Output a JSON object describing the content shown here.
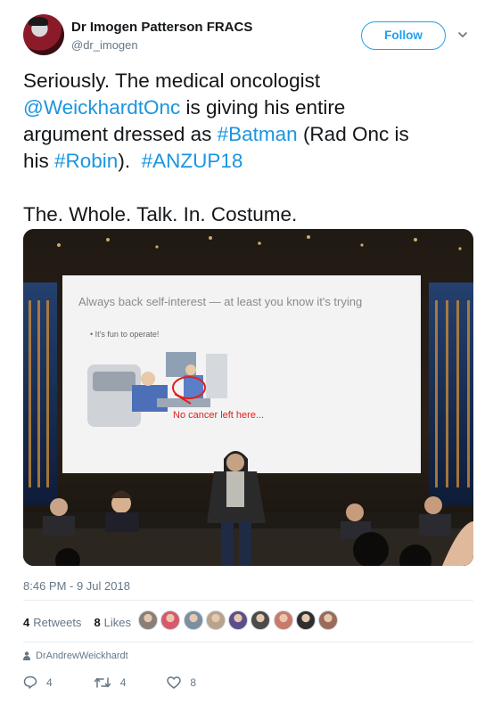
{
  "author": {
    "name": "Dr Imogen Patterson FRACS",
    "handle": "@dr_imogen"
  },
  "follow_label": "Follow",
  "tweet": {
    "line1": "Seriously. The medical oncologist",
    "line2_link": "@WeickhardtOnc",
    "line2_rest": " is giving his entire",
    "line3_pre": "argument dressed as ",
    "line3_link": "#Batman",
    "line3_rest": " (Rad Onc is",
    "line4_pre": "his ",
    "line4_link1": "#Robin",
    "line4_mid": ").  ",
    "line4_link2": "#ANZUP18",
    "line5": "The. Whole. Talk. In. Costume."
  },
  "slide": {
    "title": "Always back self-interest — at least you know it's trying",
    "bullet": "• It's fun to operate!",
    "caption": "No cancer left here..."
  },
  "timestamp": "8:46 PM - 9 Jul 2018",
  "stats": {
    "retweets_count": "4",
    "retweets_label": "Retweets",
    "likes_count": "8",
    "likes_label": "Likes"
  },
  "liker_colors": [
    "#8a7f76",
    "#d65a6b",
    "#7a8fa0",
    "#b8a48c",
    "#5d4e8c",
    "#4b4b4b",
    "#c97a6a",
    "#2f2f2f",
    "#9a6b5b"
  ],
  "attribution": "DrAndrewWeickhardt",
  "actions": {
    "replies": "4",
    "retweets": "4",
    "likes": "8"
  },
  "colors": {
    "link": "#1b95e0",
    "follow": "#1da1f2",
    "muted": "#657786"
  }
}
